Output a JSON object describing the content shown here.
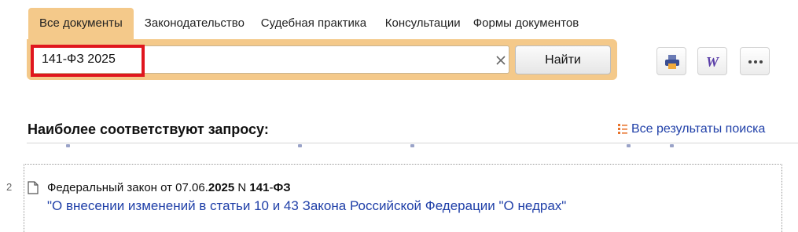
{
  "tabs": [
    {
      "label": "Все документы",
      "active": true
    },
    {
      "label": "Законодательство",
      "active": false
    },
    {
      "label": "Судебная практика",
      "active": false
    },
    {
      "label": "Консультации",
      "active": false
    },
    {
      "label": "Формы документов",
      "active": false
    }
  ],
  "search": {
    "query": "141-ФЗ 2025",
    "button_label": "Найти",
    "clear_icon": "close-icon"
  },
  "toolbar": {
    "icons": [
      "print-icon",
      "word-export-icon",
      "more-icon"
    ],
    "word_glyph": "W",
    "more_glyph": "•••"
  },
  "results": {
    "heading": "Наиболее соответствуют запросу:",
    "all_results_label": "Все результаты поиска",
    "items": [
      {
        "number": "2",
        "title_prefix": "Федеральный закон от 07.06.",
        "title_year": "2025",
        "title_mid": " N ",
        "title_num": "141",
        "title_dash": "-",
        "title_fz": "ФЗ",
        "link": "\"О внесении изменений в статьи 10 и 43 Закона Российской Федерации \"О недрах\""
      }
    ]
  },
  "colors": {
    "accent": "#f4c98a",
    "link": "#1f3fa8",
    "highlight": "#e0161e"
  }
}
